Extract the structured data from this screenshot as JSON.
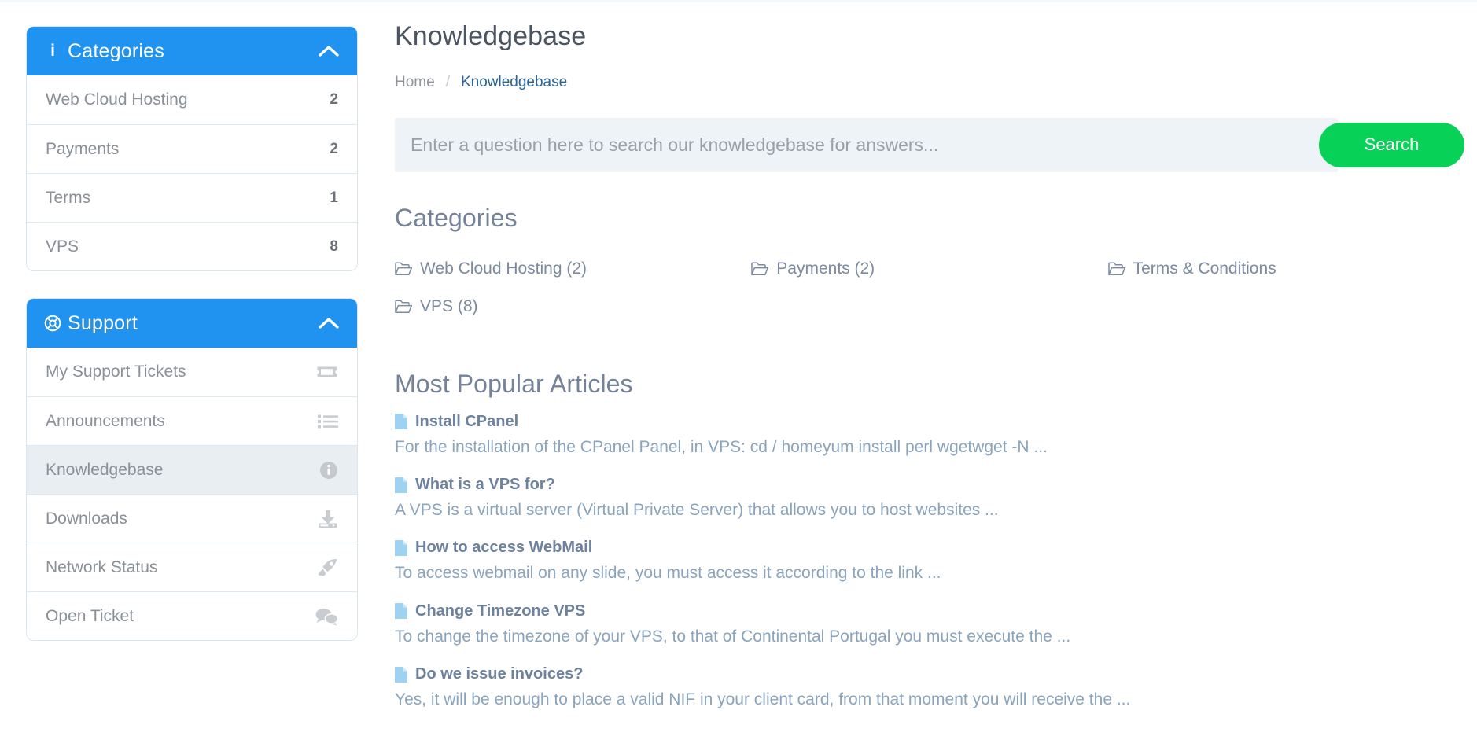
{
  "colors": {
    "panel_header_blue": "#2092f0",
    "search_button_green": "#07d257",
    "active_row_bg": "#e9eef2",
    "link_blue": "#7b8aa0",
    "article_title": "#6d829e"
  },
  "sidebar": {
    "categories_panel": {
      "icon": "info-icon",
      "title": "Categories",
      "collapse_icon": "chevron-up-icon",
      "items": [
        {
          "label": "Web Cloud Hosting",
          "count": "2"
        },
        {
          "label": "Payments",
          "count": "2"
        },
        {
          "label": "Terms",
          "count": "1"
        },
        {
          "label": "VPS",
          "count": "8"
        }
      ]
    },
    "support_panel": {
      "icon": "life-ring-icon",
      "title": "Support",
      "collapse_icon": "chevron-up-icon",
      "items": [
        {
          "label": "My Support Tickets",
          "icon": "ticket-icon",
          "active": false
        },
        {
          "label": "Announcements",
          "icon": "list-icon",
          "active": false
        },
        {
          "label": "Knowledgebase",
          "icon": "info-circle-icon",
          "active": true
        },
        {
          "label": "Downloads",
          "icon": "download-icon",
          "active": false
        },
        {
          "label": "Network Status",
          "icon": "rocket-icon",
          "active": false
        },
        {
          "label": "Open Ticket",
          "icon": "comments-icon",
          "active": false
        }
      ]
    }
  },
  "main": {
    "page_title": "Knowledgebase",
    "breadcrumb": {
      "home": "Home",
      "separator": "/",
      "current": "Knowledgebase"
    },
    "search": {
      "placeholder": "Enter a question here to search our knowledgebase for answers...",
      "value": "",
      "button_label": "Search"
    },
    "categories_section": {
      "title": "Categories",
      "items": [
        {
          "label": "Web Cloud Hosting (2)",
          "icon": "folder-open-icon"
        },
        {
          "label": "Payments (2)",
          "icon": "folder-open-icon"
        },
        {
          "label": "Terms & Conditions",
          "icon": "folder-open-icon"
        },
        {
          "label": "VPS (8)",
          "icon": "folder-open-icon"
        }
      ]
    },
    "popular_section": {
      "title": "Most Popular Articles",
      "articles": [
        {
          "icon": "file-icon",
          "title": "Install CPanel",
          "snippet": "For the installation of the CPanel Panel, in VPS: cd / homeyum install perl wgetwget -N ..."
        },
        {
          "icon": "file-icon",
          "title": "What is a VPS for?",
          "snippet": "A VPS is a virtual server (Virtual Private Server) that allows you to host websites ..."
        },
        {
          "icon": "file-icon",
          "title": "How to access WebMail",
          "snippet": "To access webmail on any slide, you must access it according to the link ..."
        },
        {
          "icon": "file-icon",
          "title": "Change Timezone VPS",
          "snippet": "To change the timezone of your VPS, to that of Continental Portugal you must execute the ..."
        },
        {
          "icon": "file-icon",
          "title": "Do we issue invoices?",
          "snippet": "Yes, it will be enough to place a valid NIF in your client card, from that moment you will receive the ..."
        }
      ]
    }
  }
}
